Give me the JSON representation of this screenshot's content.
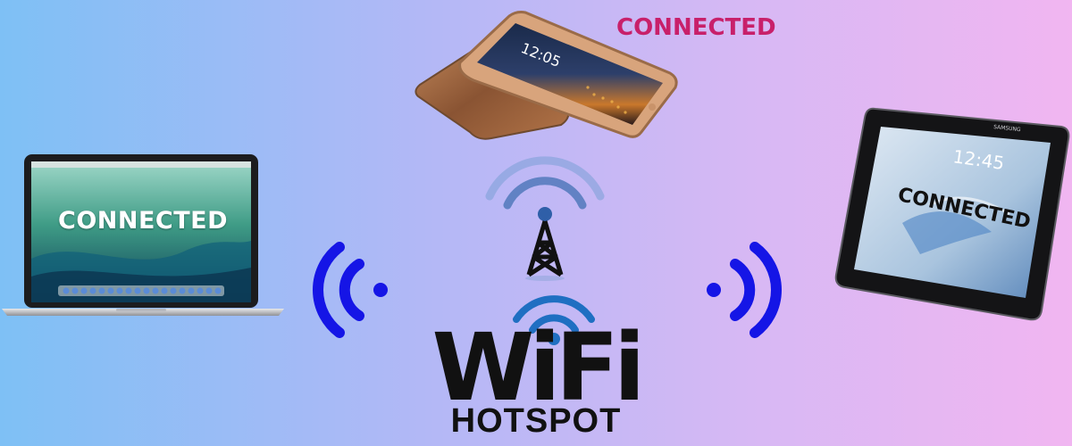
{
  "devices": {
    "laptop": {
      "label": "CONNECTED"
    },
    "phone": {
      "label": "CONNECTED",
      "clock": "12:05"
    },
    "tablet": {
      "label": "CONNECTED",
      "clock": "12:45",
      "brand": "SAMSUNG"
    }
  },
  "logo": {
    "word": "WiFi",
    "subtitle": "HOTSPOT"
  },
  "colors": {
    "background_left": "#7ec0f5",
    "background_right": "#f1b6f1",
    "wave_blue": "#1515e6",
    "tower_waves": "#4a74b8",
    "phone_label": "#c8206a",
    "text_dark": "#111111"
  }
}
